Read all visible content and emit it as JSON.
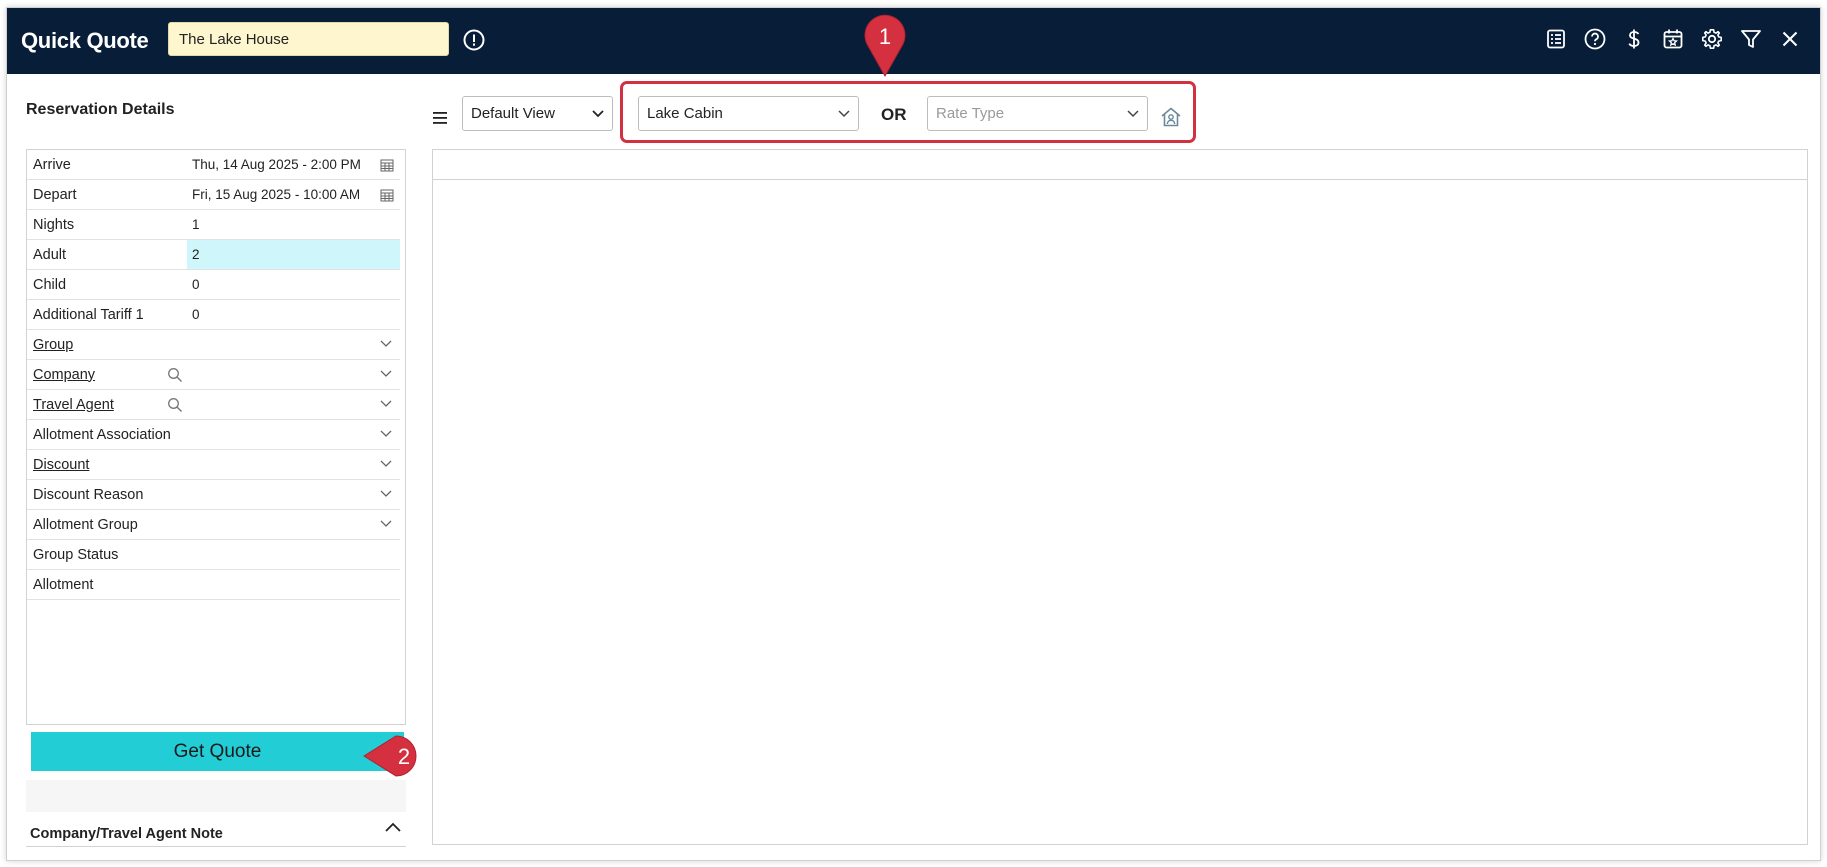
{
  "header": {
    "title": "Quick Quote",
    "property_value": "The Lake House",
    "icons": [
      "info-icon",
      "list-icon",
      "help-icon",
      "dollar-icon",
      "calendar-star-icon",
      "gear-icon",
      "filter-icon",
      "close-icon"
    ]
  },
  "reservation": {
    "title": "Reservation Details",
    "rows": [
      {
        "label": "Arrive",
        "value": "Thu, 14 Aug 2025 - 2:00 PM"
      },
      {
        "label": "Depart",
        "value": "Fri, 15 Aug 2025 - 10:00 AM"
      },
      {
        "label": "Nights",
        "value": "1"
      },
      {
        "label": "Adult",
        "value": "2"
      },
      {
        "label": "Child",
        "value": "0"
      },
      {
        "label": "Additional Tariff 1",
        "value": "0"
      },
      {
        "label": "Group",
        "value": ""
      },
      {
        "label": "Company",
        "value": ""
      },
      {
        "label": "Travel Agent",
        "value": ""
      },
      {
        "label": "Allotment Association",
        "value": ""
      },
      {
        "label": "Discount",
        "value": ""
      },
      {
        "label": "Discount Reason",
        "value": ""
      },
      {
        "label": "Allotment Group",
        "value": ""
      },
      {
        "label": "Group Status",
        "value": ""
      },
      {
        "label": "Allotment",
        "value": ""
      }
    ],
    "get_quote_label": "Get Quote",
    "note_title": "Company/Travel Agent Note"
  },
  "toolbar": {
    "view_select": "Default View",
    "room_type": "Lake Cabin",
    "or_label": "OR",
    "rate_type_placeholder": "Rate Type"
  },
  "callouts": [
    "1",
    "2"
  ],
  "colors": {
    "header_bg": "#071d38",
    "accent_button": "#23cdd6",
    "highlight": "#d4303f",
    "adult_highlight": "#cff6fa",
    "property_field": "#fdf6cf"
  }
}
